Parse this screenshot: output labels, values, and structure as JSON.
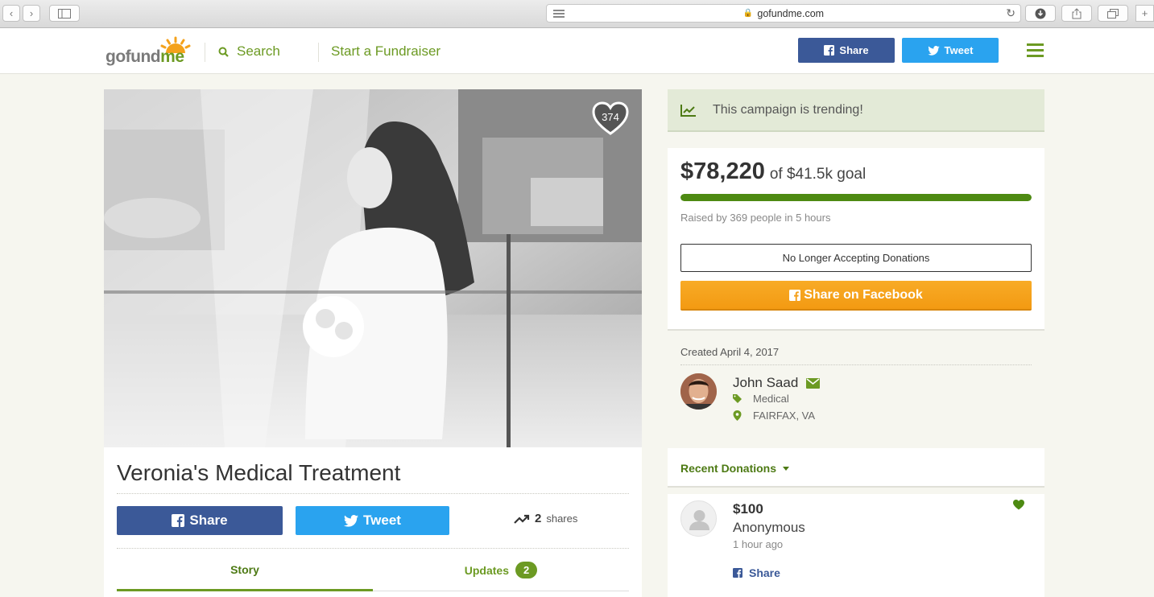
{
  "browser": {
    "url": "gofundme.com",
    "back_icon": "chevron-left-icon",
    "forward_icon": "chevron-right-icon"
  },
  "header": {
    "logo_go": "go",
    "logo_fund": "fund",
    "logo_me": "me",
    "search_label": "Search",
    "start_label": "Start a Fundraiser",
    "share_label": "Share",
    "tweet_label": "Tweet",
    "colors": {
      "green": "#6c9a23",
      "facebook": "#3b5998",
      "twitter": "#2aa3ef"
    }
  },
  "campaign": {
    "hearts": "374",
    "title": "Veronia's Medical Treatment",
    "share_label": "Share",
    "tweet_label": "Tweet",
    "shares_count": "2",
    "shares_label": "shares",
    "tabs": {
      "story": "Story",
      "updates": "Updates",
      "updates_count": "2"
    }
  },
  "sidebar": {
    "trending": "This campaign is trending!",
    "raised_amount": "$78,220",
    "goal_text": "of $41.5k goal",
    "progress_fraction": 1.0,
    "raised_by": "Raised by 369 people in 5 hours",
    "no_longer": "No Longer Accepting Donations",
    "fb_share": "Share on Facebook",
    "created": "Created April 4, 2017",
    "organizer": "John Saad",
    "category": "Medical",
    "location": "FAIRFAX, VA",
    "recent_donations": "Recent Donations",
    "donation": {
      "amount": "$100",
      "name": "Anonymous",
      "time": "1 hour ago",
      "share": "Share"
    }
  }
}
